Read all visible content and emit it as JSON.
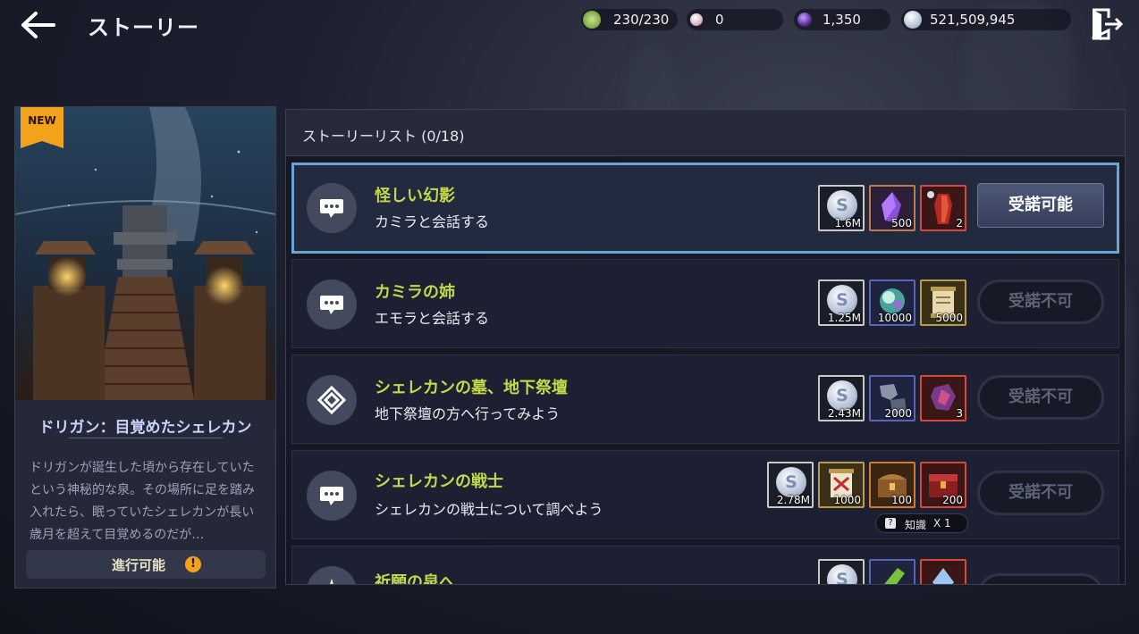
{
  "header": {
    "title": "ストーリー",
    "currencies": [
      {
        "icon": "stamina-icon",
        "value": "230/230"
      },
      {
        "icon": "pearl-icon",
        "value": "0"
      },
      {
        "icon": "dark-orb-icon",
        "value": "1,350"
      },
      {
        "icon": "silver-coin-icon",
        "value": "521,509,945"
      }
    ]
  },
  "story_card": {
    "badge": "NEW",
    "title": "ドリガン：目覚めたシェレカン",
    "description": "ドリガンが誕生した頃から存在していたという神秘的な泉。その場所に足を踏み入れたら、眠っていたシェレカンが長い歳月を超えて目覚めるのだが…",
    "status": "進行可能",
    "status_mark": "!"
  },
  "story_list": {
    "header": "ストーリーリスト (0/18)",
    "quests": [
      {
        "title": "怪しい幻影",
        "subtitle": "カミラと会話する",
        "icon": "chat-icon",
        "selected": true,
        "rewards": [
          {
            "icon": "silver-coin-icon",
            "qty": "1.6M"
          },
          {
            "icon": "purple-crystal-icon",
            "qty": "500"
          },
          {
            "icon": "red-armor-icon",
            "qty": "2"
          }
        ],
        "button": "受諾可能",
        "available": true
      },
      {
        "title": "カミラの姉",
        "subtitle": "エモラと会話する",
        "icon": "chat-icon",
        "rewards": [
          {
            "icon": "silver-coin-icon",
            "qty": "1.25M"
          },
          {
            "icon": "spirit-orb-icon",
            "qty": "10000"
          },
          {
            "icon": "scroll-icon",
            "qty": "5000"
          }
        ],
        "button": "受諾不可",
        "available": false
      },
      {
        "title": "シェレカンの墓、地下祭壇",
        "subtitle": "地下祭壇の方へ行ってみよう",
        "icon": "location-diamond-icon",
        "rewards": [
          {
            "icon": "silver-coin-icon",
            "qty": "2.43M"
          },
          {
            "icon": "black-stone-icon",
            "qty": "2000"
          },
          {
            "icon": "red-crystal-icon",
            "qty": "3"
          }
        ],
        "button": "受諾不可",
        "available": false
      },
      {
        "title": "シェレカンの戦士",
        "subtitle": "シェレカンの戦士について調べよう",
        "icon": "chat-icon",
        "rewards": [
          {
            "icon": "silver-coin-icon",
            "qty": "2.78M"
          },
          {
            "icon": "red-scroll-icon",
            "qty": "1000"
          },
          {
            "icon": "treasure-chest-icon",
            "qty": "100"
          },
          {
            "icon": "red-chest-icon",
            "qty": "200"
          }
        ],
        "knowledge": {
          "icon": "question-icon",
          "label": "知識",
          "count": "X 1"
        },
        "button": "受諾不可",
        "available": false
      },
      {
        "title": "祈願の泉へ",
        "subtitle": "",
        "icon": "star-icon",
        "rewards": [
          {
            "icon": "silver-coin-icon",
            "qty": ""
          },
          {
            "icon": "green-crystal-icon",
            "qty": ""
          },
          {
            "icon": "blue-crystal-icon",
            "qty": ""
          }
        ],
        "button": "",
        "available": false
      }
    ]
  },
  "colors": {
    "quest_title": "#c4d94a",
    "selected_border": "#6aa4d6",
    "badge": "#f2a21b"
  }
}
